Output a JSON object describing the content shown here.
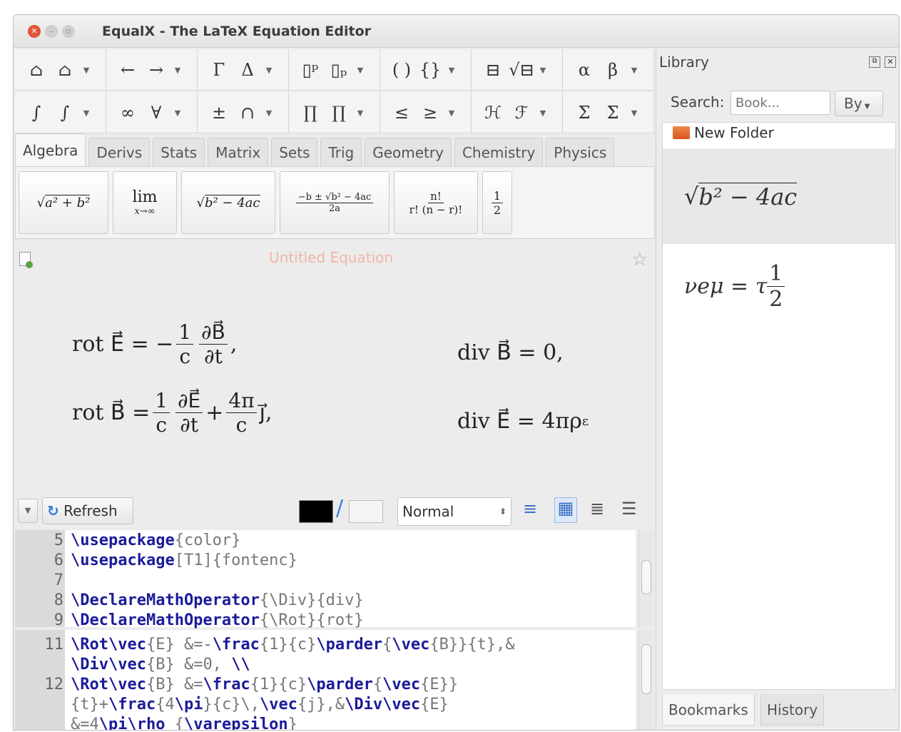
{
  "window": {
    "title": "EqualX - The LaTeX Equation Editor"
  },
  "toolbar": {
    "row1": [
      {
        "icon": "template-icon",
        "syms": [
          "⌂",
          "⌂"
        ]
      },
      {
        "icon": "arrows-icon",
        "syms": [
          "←",
          "→"
        ]
      },
      {
        "icon": "greek-upper-icon",
        "syms": [
          "Γ",
          "Δ"
        ]
      },
      {
        "icon": "superscript-icon",
        "syms": [
          "▯ᵖ",
          "▯ₚ"
        ]
      },
      {
        "icon": "brackets-icon",
        "syms": [
          "( )",
          "{}"
        ]
      },
      {
        "icon": "fraction-icon",
        "syms": [
          "⊟",
          "√⊟"
        ]
      },
      {
        "icon": "greek-lower-icon",
        "syms": [
          "α",
          "β"
        ]
      }
    ],
    "row2": [
      {
        "icon": "integral-icon",
        "syms": [
          "∫",
          "∫"
        ]
      },
      {
        "icon": "logic-icon",
        "syms": [
          "∞",
          "∀"
        ]
      },
      {
        "icon": "operators-icon",
        "syms": [
          "±",
          "∩"
        ]
      },
      {
        "icon": "product-icon",
        "syms": [
          "∏",
          "∏"
        ]
      },
      {
        "icon": "relations-icon",
        "syms": [
          "≤",
          "≥"
        ]
      },
      {
        "icon": "script-letters-icon",
        "syms": [
          "ℋ",
          "ℱ"
        ]
      },
      {
        "icon": "sum-icon",
        "syms": [
          "Σ",
          "Σ"
        ]
      }
    ]
  },
  "tabs": [
    "Algebra",
    "Derivs",
    "Stats",
    "Matrix",
    "Sets",
    "Trig",
    "Geometry",
    "Chemistry",
    "Physics"
  ],
  "formulas": {
    "f1": {
      "rad": "a² + b²"
    },
    "f2": {
      "top": "lim",
      "bottom": "x→∞"
    },
    "f3": {
      "rad": "b² − 4ac"
    },
    "f4": {
      "num": "−b ± √b² − 4ac",
      "den": "2a"
    },
    "f5": {
      "num": "n!",
      "den": "r! (n − r)!"
    },
    "f6": {
      "num": "1",
      "den": "2"
    }
  },
  "editor": {
    "title": "Untitled Equation",
    "rows": [
      {
        "left": {
          "lhs": "rot E⃗ = −",
          "f1n": "1",
          "f1d": "c",
          "f2n": "∂B⃗",
          "f2d": "∂t",
          "tail": ","
        },
        "right": "div B⃗ = 0,"
      },
      {
        "left": {
          "lhs": "rot B⃗ = ",
          "f1n": "1",
          "f1d": "c",
          "f2n": "∂E⃗",
          "f2d": "∂t",
          "mid": " + ",
          "f3n": "4π",
          "f3d": "c",
          "tail": " j⃗,"
        },
        "right": "div E⃗ = 4πρ",
        "right_sub": "ε"
      }
    ]
  },
  "controls": {
    "refresh": "Refresh",
    "size": "Normal",
    "fg_color": "#000000",
    "bg_color": "#f4f4f4"
  },
  "preamble": [
    {
      "n": "5",
      "cmd": "\\usepackage",
      "args": "{color}"
    },
    {
      "n": "6",
      "cmd": "\\usepackage",
      "args": "[T1]{fontenc}"
    },
    {
      "n": "7",
      "cmd": "",
      "args": ""
    },
    {
      "n": "8",
      "cmd": "\\DeclareMathOperator",
      "args": "{\\Div}{div}"
    },
    {
      "n": "9",
      "cmd": "\\DeclareMathOperator",
      "args": "{\\Rot}{rot}"
    }
  ],
  "body_code": [
    {
      "n": "11",
      "parts": [
        [
          "k",
          "\\Rot\\vec"
        ],
        [
          "a",
          "{E} &=-"
        ],
        [
          "k",
          "\\frac"
        ],
        [
          "a",
          "{1}{c}"
        ],
        [
          "k",
          "\\parder"
        ],
        [
          "a",
          "{"
        ],
        [
          "k",
          "\\vec"
        ],
        [
          "a",
          "{B}}{t},&"
        ]
      ]
    },
    {
      "n": "",
      "parts": [
        [
          "k",
          "\\Div\\vec"
        ],
        [
          "a",
          "{B} &=0, "
        ],
        [
          "k",
          "\\\\"
        ]
      ]
    },
    {
      "n": "12",
      "parts": [
        [
          "k",
          "\\Rot\\vec"
        ],
        [
          "a",
          "{B} &="
        ],
        [
          "k",
          "\\frac"
        ],
        [
          "a",
          "{1}{c}"
        ],
        [
          "k",
          "\\parder"
        ],
        [
          "a",
          "{"
        ],
        [
          "k",
          "\\vec"
        ],
        [
          "a",
          "{E}}"
        ]
      ]
    },
    {
      "n": "",
      "parts": [
        [
          "a",
          "{t}+"
        ],
        [
          "k",
          "\\frac"
        ],
        [
          "a",
          "{4"
        ],
        [
          "k",
          "\\pi"
        ],
        [
          "a",
          "}{c}\\,"
        ],
        [
          "k",
          "\\vec"
        ],
        [
          "a",
          "{j},&"
        ],
        [
          "k",
          "\\Div\\vec"
        ],
        [
          "a",
          "{E}"
        ]
      ]
    },
    {
      "n": "",
      "parts": [
        [
          "a",
          "&=4"
        ],
        [
          "k",
          "\\pi\\rho"
        ],
        [
          "a",
          "_{"
        ],
        [
          "k",
          "\\varepsilon"
        ],
        [
          "a",
          "}"
        ]
      ]
    }
  ],
  "library": {
    "title": "Library",
    "search_label": "Search:",
    "search_placeholder": "Book...",
    "by_label": "By",
    "folder": "New Folder",
    "item1": {
      "rad": "b² − 4ac"
    },
    "item2": {
      "lhs": "νeμ = τ",
      "num": "1",
      "den": "2"
    },
    "tabs": [
      "Bookmarks",
      "History"
    ]
  }
}
